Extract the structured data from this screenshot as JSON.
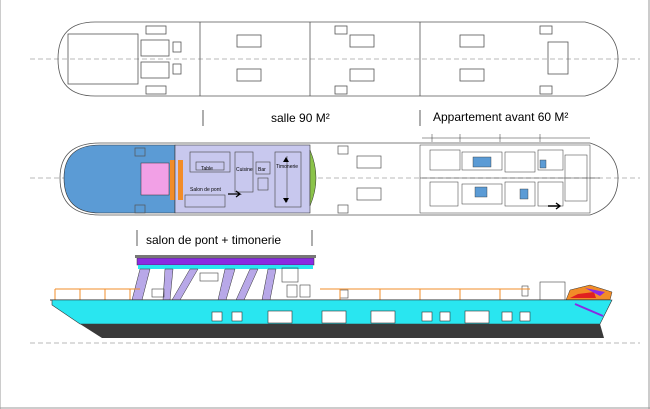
{
  "labels": {
    "salle": "salle 90 M²",
    "appartement": "Appartement avant  60 M²",
    "salon_timonerie": "salon de pont + timonerie"
  },
  "plan_labels": {
    "table": "Table",
    "salon_de_pont": "Salon de pont",
    "cuisine": "Cuisine",
    "bar": "Bar",
    "timonerie": "Timonerie"
  },
  "colors": {
    "deck_blue": "#5b9bd5",
    "wheelhouse_lavender": "#c8c8ee",
    "pink_panel": "#f2a0e6",
    "orange": "#f28c28",
    "green_bow": "#8bc34a",
    "hull_cyan": "#29e6f0",
    "hull_dark": "#3a3a3a",
    "purple_roof": "#8a2be2",
    "column_lavender": "#b8a8e8"
  }
}
